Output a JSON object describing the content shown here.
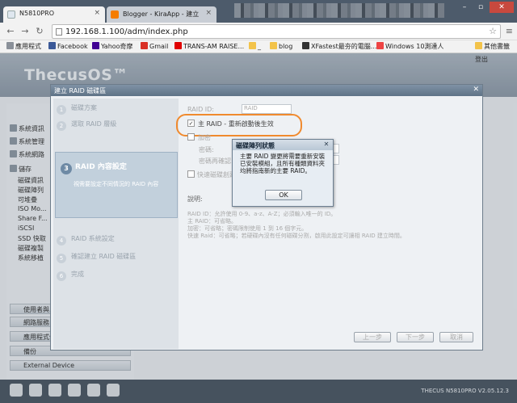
{
  "browser": {
    "tabs": [
      {
        "title": "N5810PRO",
        "color": "#e8eef5",
        "active": true
      },
      {
        "title": "Blogger - KiraApp - 建立",
        "color": "#f57d00",
        "active": false
      }
    ],
    "url": "192.168.1.100/adm/index.php",
    "bookmarks": [
      {
        "label": "應用程式",
        "color": "#8a9099"
      },
      {
        "label": "Facebook",
        "color": "#3b5998"
      },
      {
        "label": "Yahoo奇摩",
        "color": "#410093"
      },
      {
        "label": "Gmail",
        "color": "#d93025"
      },
      {
        "label": "TRANS-AM RAISE...",
        "color": "#e00000"
      },
      {
        "label": "_",
        "color": "#f3c34a"
      },
      {
        "label": "blog",
        "color": "#f3c34a"
      },
      {
        "label": "XFastest最夯的電腦...",
        "color": "#333"
      },
      {
        "label": "Windows 10測達人",
        "color": "#e44"
      },
      {
        "label": "其他書籤",
        "color": "#f3c34a"
      }
    ]
  },
  "app": {
    "logo": "ThecusOS™",
    "logout": "登出",
    "version": "THECUS N5810PRO V2.05.12.3",
    "sidebar_items": [
      "系統資訊",
      "系統管理",
      "系統網路",
      "儲存",
      "磁碟資訊",
      "磁碟陣列",
      "可堆疊",
      "ISO Mo...",
      "Share F...",
      "iSCSI",
      "SSD 快取",
      "磁碟複製",
      "系統移植"
    ],
    "sidebar_bars": [
      "使用者與...",
      "網路服務",
      "應用程式伺服器",
      "備份",
      "External Device"
    ]
  },
  "wizard": {
    "title": "建立 RAID 磁碟區",
    "steps": [
      {
        "num": "1",
        "label": "磁碟方案"
      },
      {
        "num": "2",
        "label": "選取 RAID 層級"
      },
      {
        "num": "4",
        "label": "RAID 系統設定"
      },
      {
        "num": "5",
        "label": "確認建立 RAID 磁碟區"
      },
      {
        "num": "6",
        "label": "完成"
      }
    ],
    "active_step": {
      "num": "3",
      "label": "RAID 內容設定",
      "desc": "視需要設定不同情況的 RAID 內容"
    },
    "fields": {
      "raid_id_label": "RAID ID:",
      "raid_id_value": "RAID",
      "master_raid": "主 RAID - 重新啟動後生效",
      "encrypt_label": "加密",
      "password_label": "密碼:",
      "confirm_label": "密碼再確認:",
      "quick_raid": "快速磁碟創建"
    },
    "explain_title": "說明:",
    "notes": [
      "RAID ID：允許使用 0-9、a-z、A-Z；必須輸入唯一的 ID。",
      "主 RAID：可省略。",
      "加密：可省略；密碼限制使用 1 到 16 個字元。",
      "快速 Raid：可省略；若硬碟內沒有任何磁碟分割，啟用此設定可讓相 RAID 建立時間。"
    ],
    "buttons": {
      "prev": "上一步",
      "next": "下一步",
      "cancel": "取消"
    }
  },
  "message": {
    "title": "磁碟陣列狀態",
    "text": "主要 RAID 變更將需要重新安裝已安裝模組，且所有種類資料夾均將指南新的主要 RAID。",
    "ok": "OK"
  },
  "colors": {
    "highlight": "#f08a2e",
    "dialog_title": "#5f7387"
  }
}
